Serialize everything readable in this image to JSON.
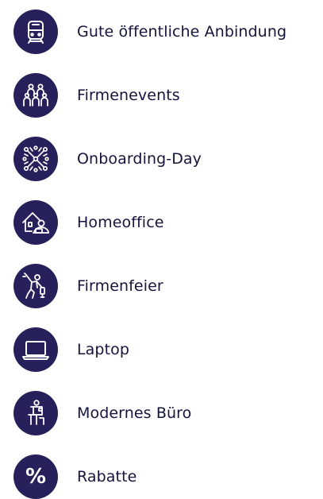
{
  "colors": {
    "icon_background": "#27215b",
    "icon_foreground": "#ffffff",
    "label_text": "#14143c"
  },
  "benefits": [
    {
      "icon": "train-icon",
      "label": "Gute öffentliche Anbindung"
    },
    {
      "icon": "group-people-icon",
      "label": "Firmenevents"
    },
    {
      "icon": "network-people-icon",
      "label": "Onboarding-Day"
    },
    {
      "icon": "home-office-icon",
      "label": "Homeoffice"
    },
    {
      "icon": "party-person-icon",
      "label": "Firmenfeier"
    },
    {
      "icon": "laptop-icon",
      "label": "Laptop"
    },
    {
      "icon": "modern-office-icon",
      "label": "Modernes Büro"
    },
    {
      "icon": "percent-icon",
      "label": "Rabatte",
      "glyph": "%"
    }
  ]
}
